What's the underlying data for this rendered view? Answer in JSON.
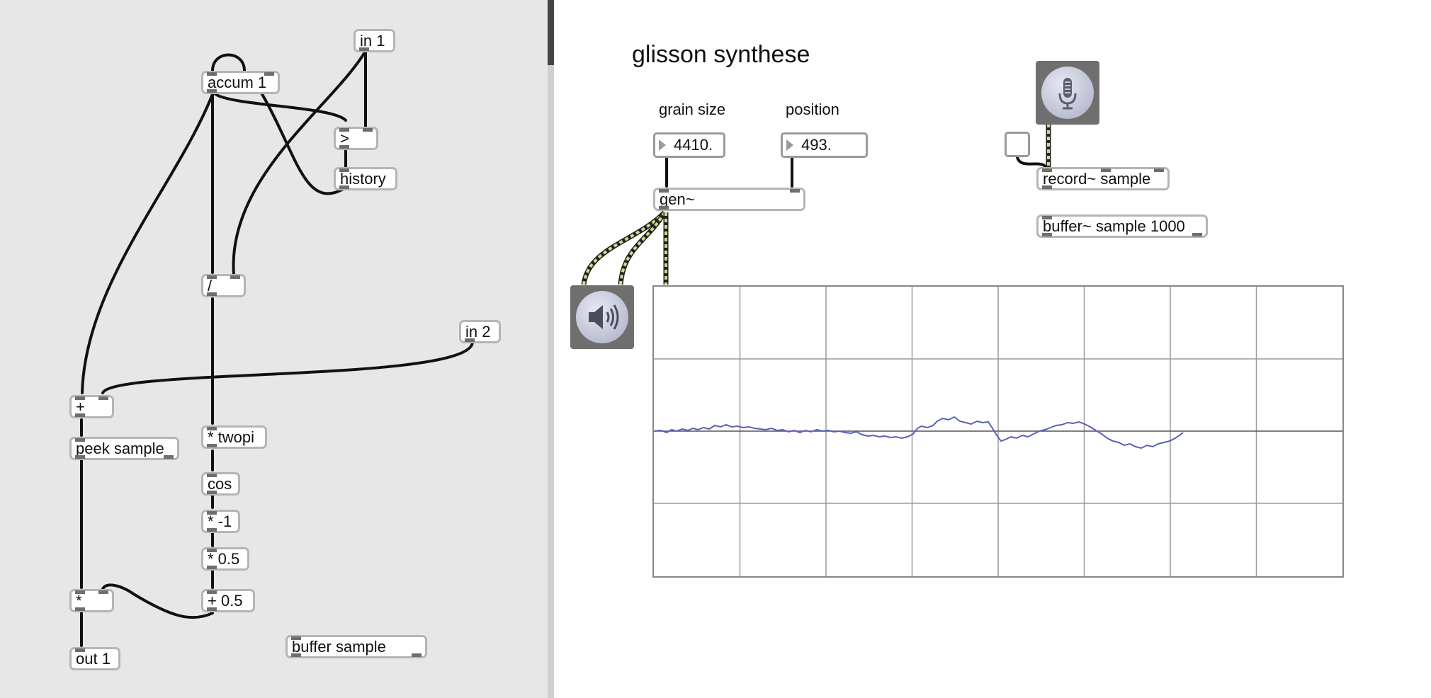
{
  "gen_patcher": {
    "objects": {
      "in1": "in 1",
      "accum": "accum 1",
      "greater": ">",
      "history": "history",
      "divide": "/",
      "in2": "in 2",
      "plus": "+",
      "peek": "peek sample",
      "twopi": "* twopi",
      "cos": "cos",
      "neg": "* -1",
      "half": "* 0.5",
      "plushalf": "+ 0.5",
      "mult": "*",
      "out1": "out 1",
      "buffer": "buffer sample"
    }
  },
  "main_patcher": {
    "title": "glisson synthese",
    "labels": {
      "grain_size": "grain size",
      "position": "position"
    },
    "numbers": {
      "grain_size": "4410.",
      "position": "493."
    },
    "objects": {
      "gen": "gen~",
      "record": "record~ sample",
      "buffer": "buffer~ sample 1000"
    },
    "icons": {
      "adc": "microphone-icon",
      "dac": "speaker-icon"
    }
  },
  "colors": {
    "signal_cable": "#c8dc8a",
    "patch_cord": "#111111",
    "scope_trace": "#5a60b8",
    "scope_grid": "#9a9a9a"
  }
}
